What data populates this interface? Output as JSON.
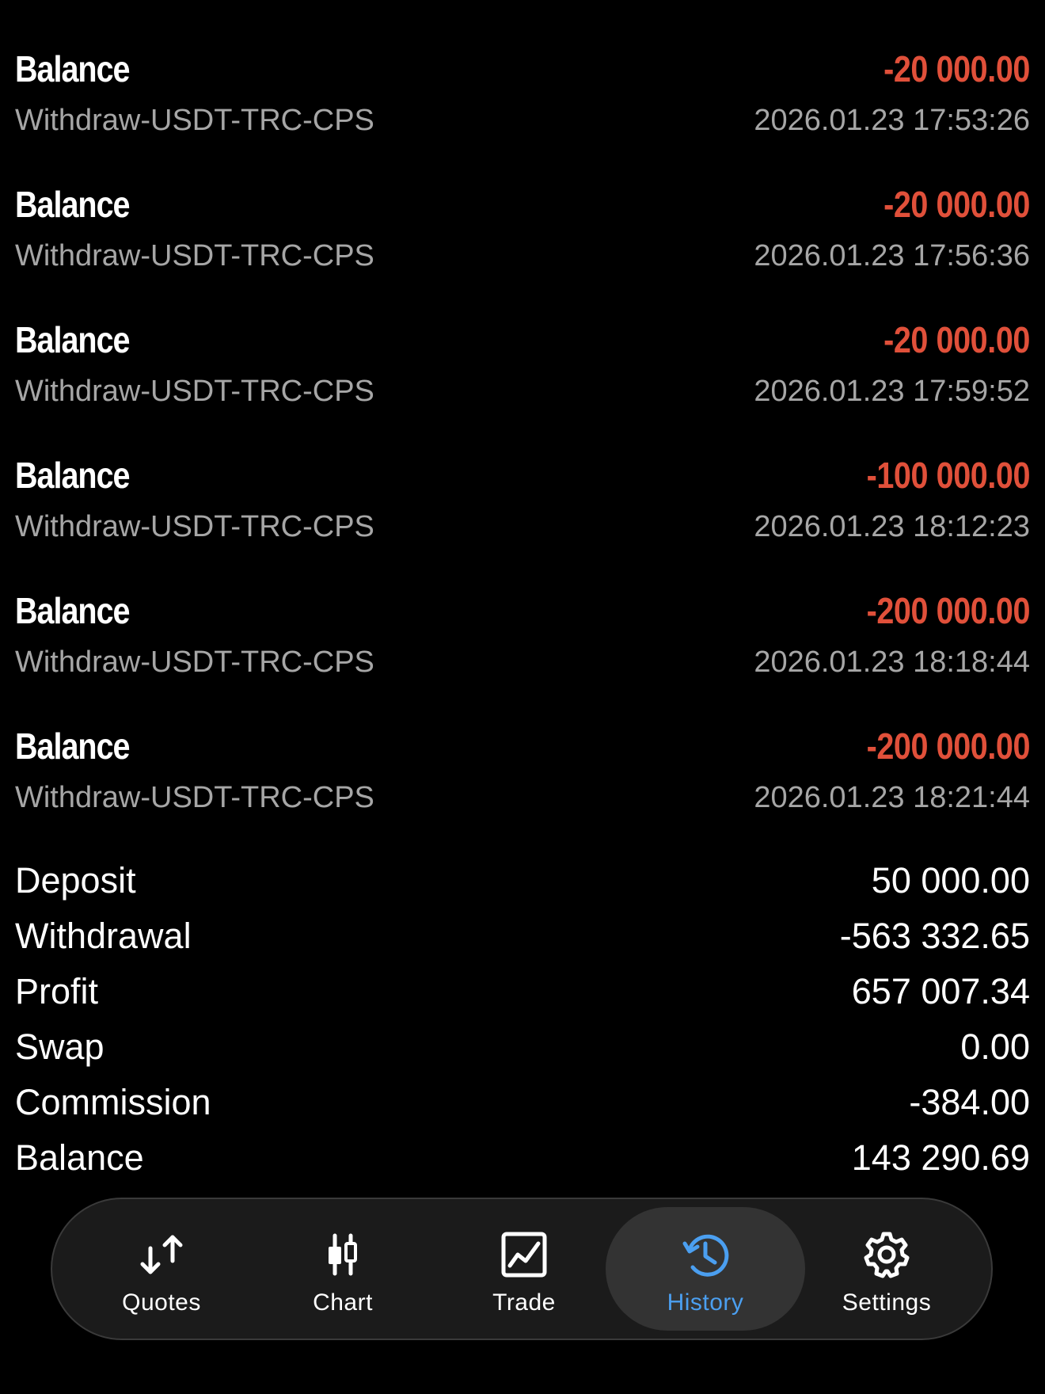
{
  "deals": [
    {
      "type": "Balance",
      "amount": "-20 000.00",
      "comment": "Withdraw-USDT-TRC-CPS",
      "time": "2026.01.23 17:53:26"
    },
    {
      "type": "Balance",
      "amount": "-20 000.00",
      "comment": "Withdraw-USDT-TRC-CPS",
      "time": "2026.01.23 17:56:36"
    },
    {
      "type": "Balance",
      "amount": "-20 000.00",
      "comment": "Withdraw-USDT-TRC-CPS",
      "time": "2026.01.23 17:59:52"
    },
    {
      "type": "Balance",
      "amount": "-100 000.00",
      "comment": "Withdraw-USDT-TRC-CPS",
      "time": "2026.01.23 18:12:23"
    },
    {
      "type": "Balance",
      "amount": "-200 000.00",
      "comment": "Withdraw-USDT-TRC-CPS",
      "time": "2026.01.23 18:18:44"
    },
    {
      "type": "Balance",
      "amount": "-200 000.00",
      "comment": "Withdraw-USDT-TRC-CPS",
      "time": "2026.01.23 18:21:44"
    }
  ],
  "summary": {
    "deposit_label": "Deposit",
    "deposit_value": "50 000.00",
    "withdrawal_label": "Withdrawal",
    "withdrawal_value": "-563 332.65",
    "profit_label": "Profit",
    "profit_value": "657 007.34",
    "swap_label": "Swap",
    "swap_value": "0.00",
    "commission_label": "Commission",
    "commission_value": "-384.00",
    "balance_label": "Balance",
    "balance_value": "143 290.69"
  },
  "tabbar": {
    "quotes": {
      "label": "Quotes",
      "icon": "quotes-arrows-icon"
    },
    "chart": {
      "label": "Chart",
      "icon": "candlestick-chart-icon"
    },
    "trade": {
      "label": "Trade",
      "icon": "trade-chart-icon"
    },
    "history": {
      "label": "History",
      "icon": "history-clock-icon"
    },
    "settings": {
      "label": "Settings",
      "icon": "gear-icon"
    },
    "active": "History"
  },
  "colors": {
    "background": "#000000",
    "negative_amount": "#e0503a",
    "secondary_text": "#a6a6a6",
    "active_tab": "#4b9ff0",
    "tabbar_bg": "#1b1b1b"
  }
}
